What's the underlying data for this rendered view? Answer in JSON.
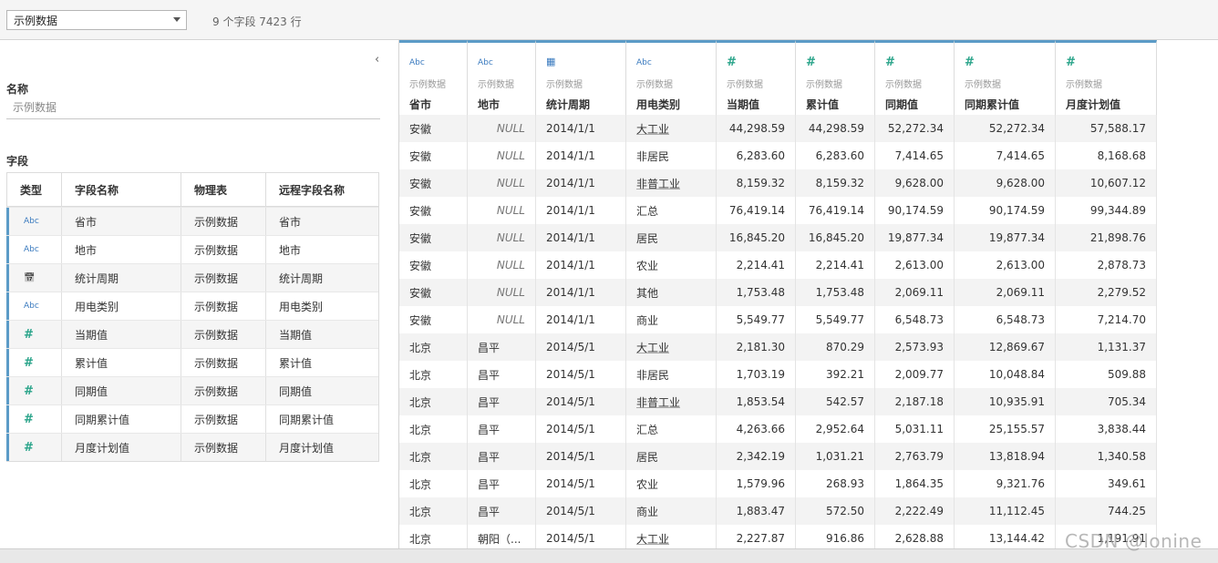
{
  "topbar": {
    "datasource": "示例数据",
    "summary": "9 个字段 7423 行"
  },
  "left": {
    "name_label": "名称",
    "name_placeholder": "示例数据",
    "fields_label": "字段",
    "columns": [
      "类型",
      "字段名称",
      "物理表",
      "远程字段名称"
    ],
    "rows": [
      {
        "type": "Abc",
        "icon": "string-type-icon",
        "name": "省市",
        "table": "示例数据",
        "remote": "省市"
      },
      {
        "type": "Abc",
        "icon": "string-type-icon",
        "name": "地市",
        "table": "示例数据",
        "remote": "地市"
      },
      {
        "type": "date",
        "icon": "date-type-icon",
        "name": "统计周期",
        "table": "示例数据",
        "remote": "统计周期"
      },
      {
        "type": "Abc",
        "icon": "string-type-icon",
        "name": "用电类别",
        "table": "示例数据",
        "remote": "用电类别"
      },
      {
        "type": "#",
        "icon": "number-type-icon",
        "name": "当期值",
        "table": "示例数据",
        "remote": "当期值"
      },
      {
        "type": "#",
        "icon": "number-type-icon",
        "name": "累计值",
        "table": "示例数据",
        "remote": "累计值"
      },
      {
        "type": "#",
        "icon": "number-type-icon",
        "name": "同期值",
        "table": "示例数据",
        "remote": "同期值"
      },
      {
        "type": "#",
        "icon": "number-type-icon",
        "name": "同期累计值",
        "table": "示例数据",
        "remote": "同期累计值"
      },
      {
        "type": "#",
        "icon": "number-type-icon",
        "name": "月度计划值",
        "table": "示例数据",
        "remote": "月度计划值"
      }
    ]
  },
  "grid": {
    "columns": [
      {
        "type": "Abc",
        "icon": "string-type-icon",
        "source": "示例数据",
        "name": "省市",
        "align": "l"
      },
      {
        "type": "Abc",
        "icon": "string-type-icon",
        "source": "示例数据",
        "name": "地市",
        "align": "l"
      },
      {
        "type": "date",
        "icon": "date-type-icon",
        "source": "示例数据",
        "name": "统计周期",
        "align": "l"
      },
      {
        "type": "Abc",
        "icon": "string-type-icon",
        "source": "示例数据",
        "name": "用电类别",
        "align": "l"
      },
      {
        "type": "#",
        "icon": "number-type-icon",
        "source": "示例数据",
        "name": "当期值",
        "align": "r"
      },
      {
        "type": "#",
        "icon": "number-type-icon",
        "source": "示例数据",
        "name": "累计值",
        "align": "r"
      },
      {
        "type": "#",
        "icon": "number-type-icon",
        "source": "示例数据",
        "name": "同期值",
        "align": "r"
      },
      {
        "type": "#",
        "icon": "number-type-icon",
        "source": "示例数据",
        "name": "同期累计值",
        "align": "r"
      },
      {
        "type": "#",
        "icon": "number-type-icon",
        "source": "示例数据",
        "name": "月度计划值",
        "align": "r"
      }
    ],
    "rows": [
      [
        "安徽",
        "NULL",
        "2014/1/1",
        "大工业",
        "44,298.59",
        "44,298.59",
        "52,272.34",
        "52,272.34",
        "57,588.17"
      ],
      [
        "安徽",
        "NULL",
        "2014/1/1",
        "非居民",
        "6,283.60",
        "6,283.60",
        "7,414.65",
        "7,414.65",
        "8,168.68"
      ],
      [
        "安徽",
        "NULL",
        "2014/1/1",
        "非普工业",
        "8,159.32",
        "8,159.32",
        "9,628.00",
        "9,628.00",
        "10,607.12"
      ],
      [
        "安徽",
        "NULL",
        "2014/1/1",
        "汇总",
        "76,419.14",
        "76,419.14",
        "90,174.59",
        "90,174.59",
        "99,344.89"
      ],
      [
        "安徽",
        "NULL",
        "2014/1/1",
        "居民",
        "16,845.20",
        "16,845.20",
        "19,877.34",
        "19,877.34",
        "21,898.76"
      ],
      [
        "安徽",
        "NULL",
        "2014/1/1",
        "农业",
        "2,214.41",
        "2,214.41",
        "2,613.00",
        "2,613.00",
        "2,878.73"
      ],
      [
        "安徽",
        "NULL",
        "2014/1/1",
        "其他",
        "1,753.48",
        "1,753.48",
        "2,069.11",
        "2,069.11",
        "2,279.52"
      ],
      [
        "安徽",
        "NULL",
        "2014/1/1",
        "商业",
        "5,549.77",
        "5,549.77",
        "6,548.73",
        "6,548.73",
        "7,214.70"
      ],
      [
        "北京",
        "昌平",
        "2014/5/1",
        "大工业",
        "2,181.30",
        "870.29",
        "2,573.93",
        "12,869.67",
        "1,131.37"
      ],
      [
        "北京",
        "昌平",
        "2014/5/1",
        "非居民",
        "1,703.19",
        "392.21",
        "2,009.77",
        "10,048.84",
        "509.88"
      ],
      [
        "北京",
        "昌平",
        "2014/5/1",
        "非普工业",
        "1,853.54",
        "542.57",
        "2,187.18",
        "10,935.91",
        "705.34"
      ],
      [
        "北京",
        "昌平",
        "2014/5/1",
        "汇总",
        "4,263.66",
        "2,952.64",
        "5,031.11",
        "25,155.57",
        "3,838.44"
      ],
      [
        "北京",
        "昌平",
        "2014/5/1",
        "居民",
        "2,342.19",
        "1,031.21",
        "2,763.79",
        "13,818.94",
        "1,340.58"
      ],
      [
        "北京",
        "昌平",
        "2014/5/1",
        "农业",
        "1,579.96",
        "268.93",
        "1,864.35",
        "9,321.76",
        "349.61"
      ],
      [
        "北京",
        "昌平",
        "2014/5/1",
        "商业",
        "1,883.47",
        "572.50",
        "2,222.49",
        "11,112.45",
        "744.25"
      ],
      [
        "北京",
        "朝阳（...",
        "2014/5/1",
        "大工业",
        "2,227.87",
        "916.86",
        "2,628.88",
        "13,144.42",
        "1,191.91"
      ]
    ]
  },
  "watermark": "CSDN @lonine"
}
